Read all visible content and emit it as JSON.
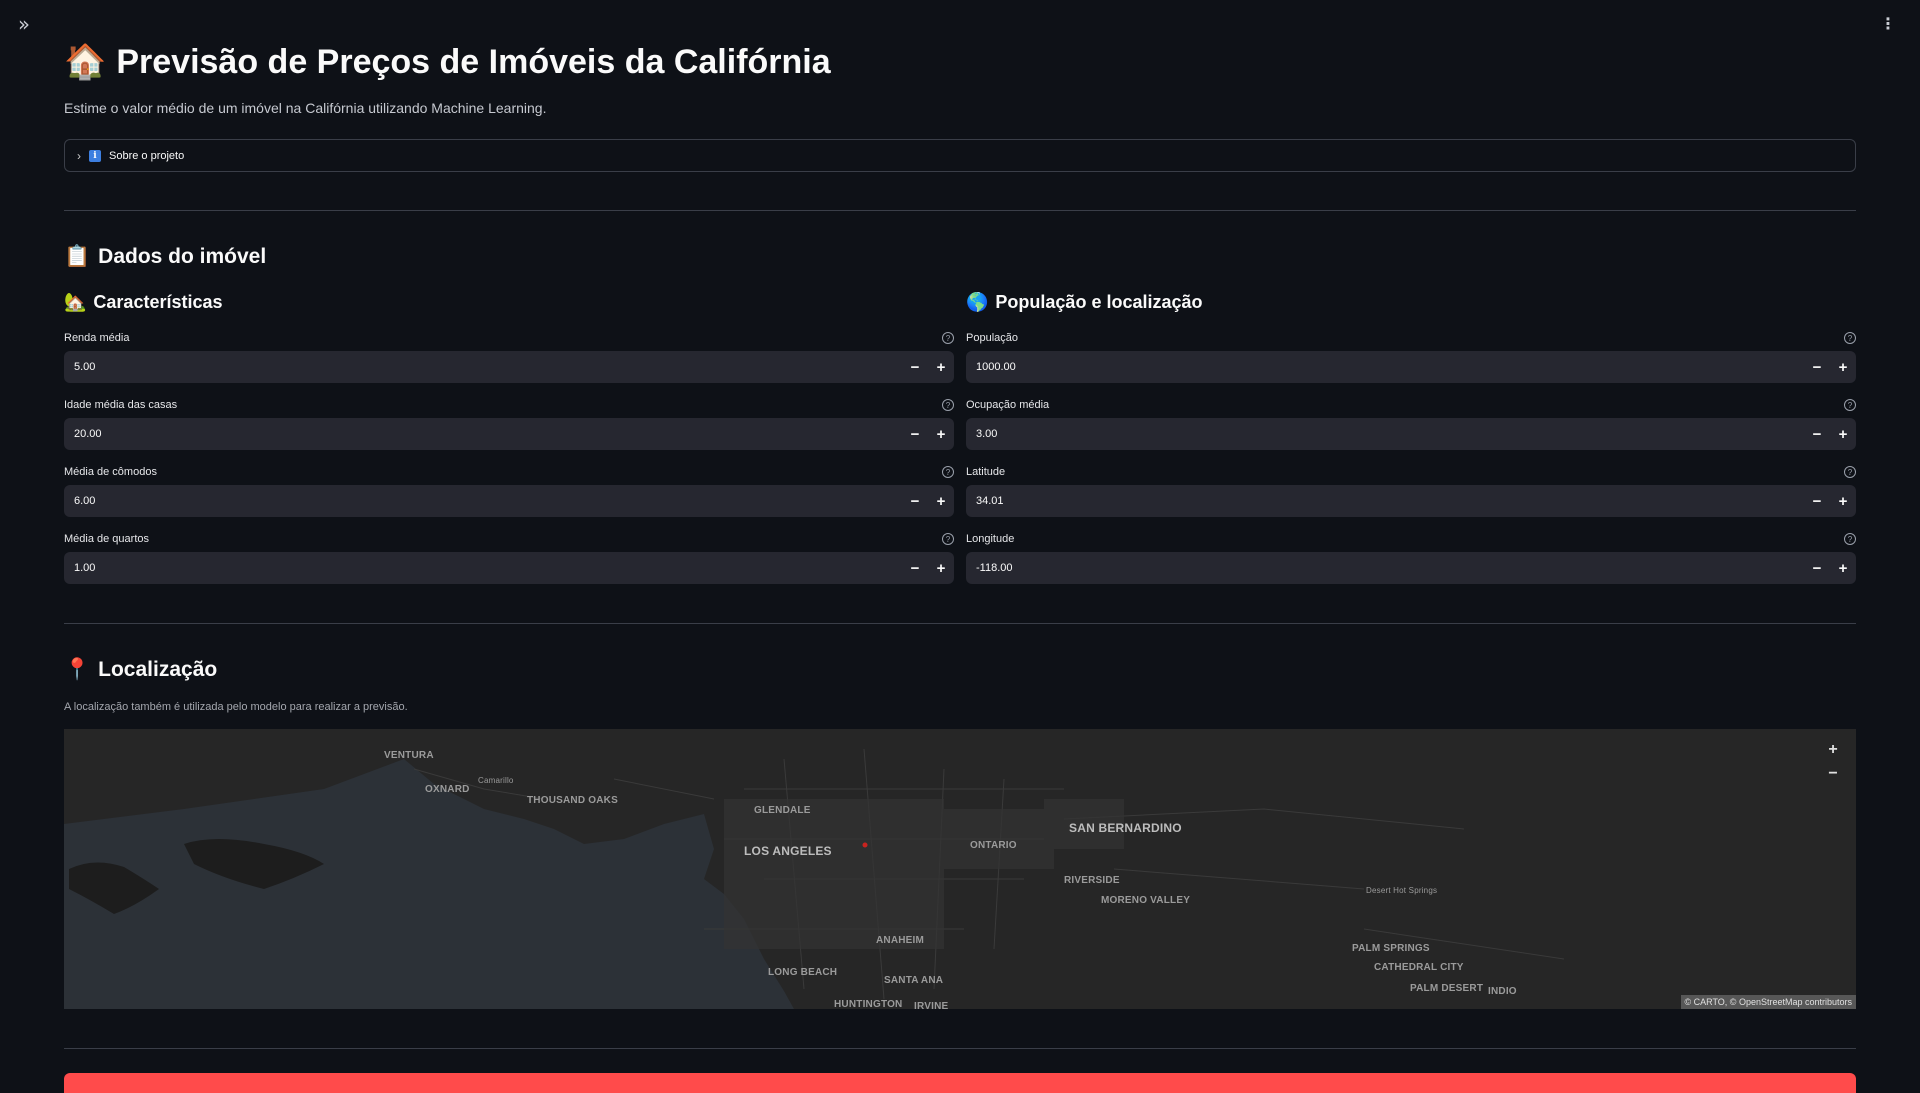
{
  "title": {
    "icon": "🏠",
    "text": "Previsão de Preços de Imóveis da Califórnia"
  },
  "subtitle": "Estime o valor médio de um imóvel na Califórnia utilizando Machine Learning.",
  "expander": {
    "label": "Sobre o projeto"
  },
  "data_section": {
    "icon": "📋",
    "title": "Dados do imóvel",
    "left": {
      "icon": "🏡",
      "title": "Características",
      "fields": [
        {
          "label": "Renda média",
          "value": "5.00"
        },
        {
          "label": "Idade média das casas",
          "value": "20.00"
        },
        {
          "label": "Média de cômodos",
          "value": "6.00"
        },
        {
          "label": "Média de quartos",
          "value": "1.00"
        }
      ]
    },
    "right": {
      "icon": "🌎",
      "title": "População e localização",
      "fields": [
        {
          "label": "População",
          "value": "1000.00"
        },
        {
          "label": "Ocupação média",
          "value": "3.00"
        },
        {
          "label": "Latitude",
          "value": "34.01"
        },
        {
          "label": "Longitude",
          "value": "-118.00"
        }
      ]
    }
  },
  "location_section": {
    "icon": "📍",
    "title": "Localização",
    "caption": "A localização também é utilizada pelo modelo para realizar a previsão."
  },
  "map": {
    "labels": [
      "VENTURA",
      "OXNARD",
      "Camarillo",
      "THOUSAND OAKS",
      "GLENDALE",
      "LOS ANGELES",
      "ONTARIO",
      "SAN BERNARDINO",
      "RIVERSIDE",
      "MORENO VALLEY",
      "ANAHEIM",
      "LONG BEACH",
      "SANTA ANA",
      "HUNTINGTON",
      "IRVINE",
      "Desert Hot Springs",
      "PALM SPRINGS",
      "CATHEDRAL CITY",
      "PALM DESERT",
      "INDIO"
    ],
    "zoom_in": "+",
    "zoom_out": "−",
    "attribution": "© CARTO, © OpenStreetMap contributors",
    "colors": {
      "land": "#262626",
      "water": "#2c3137",
      "marker": "#c8231f"
    }
  },
  "stepper": {
    "minus": "−",
    "plus": "+"
  },
  "help_glyph": "?",
  "colors": {
    "background": "#0e1117",
    "input": "#262730",
    "primary": "#ff4b4b"
  }
}
